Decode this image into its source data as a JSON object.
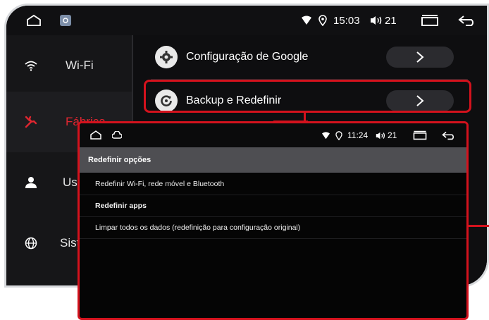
{
  "statusbar": {
    "time": "15:03",
    "volume": "21"
  },
  "sidebar": {
    "items": [
      {
        "label": "Wi-Fi",
        "icon": "wifi-icon"
      },
      {
        "label": "Fábrica",
        "icon": "wrench-icon",
        "active": true
      },
      {
        "label": "Usu",
        "icon": "user-icon"
      },
      {
        "label": "Sist",
        "icon": "globe-icon"
      }
    ]
  },
  "main": {
    "rows": [
      {
        "label": "Configuração de Google",
        "icon": "gear-icon"
      },
      {
        "label": "Backup e Redefinir",
        "icon": "reset-icon",
        "highlighted": true
      }
    ]
  },
  "overlay": {
    "statusbar": {
      "time": "11:24",
      "volume": "21"
    },
    "title": "Redefinir opções",
    "rows": [
      {
        "label": "Redefinir Wi-Fi, rede móvel e Bluetooth",
        "bold": false
      },
      {
        "label": "Redefinir apps",
        "bold": true
      },
      {
        "label": "Limpar todos os dados (redefinição para configuração original)",
        "bold": false
      }
    ]
  },
  "colors": {
    "accent": "#d4121d",
    "background": "#0e0e10",
    "sidebar": "#161618",
    "title_bar": "#4e4e52"
  }
}
